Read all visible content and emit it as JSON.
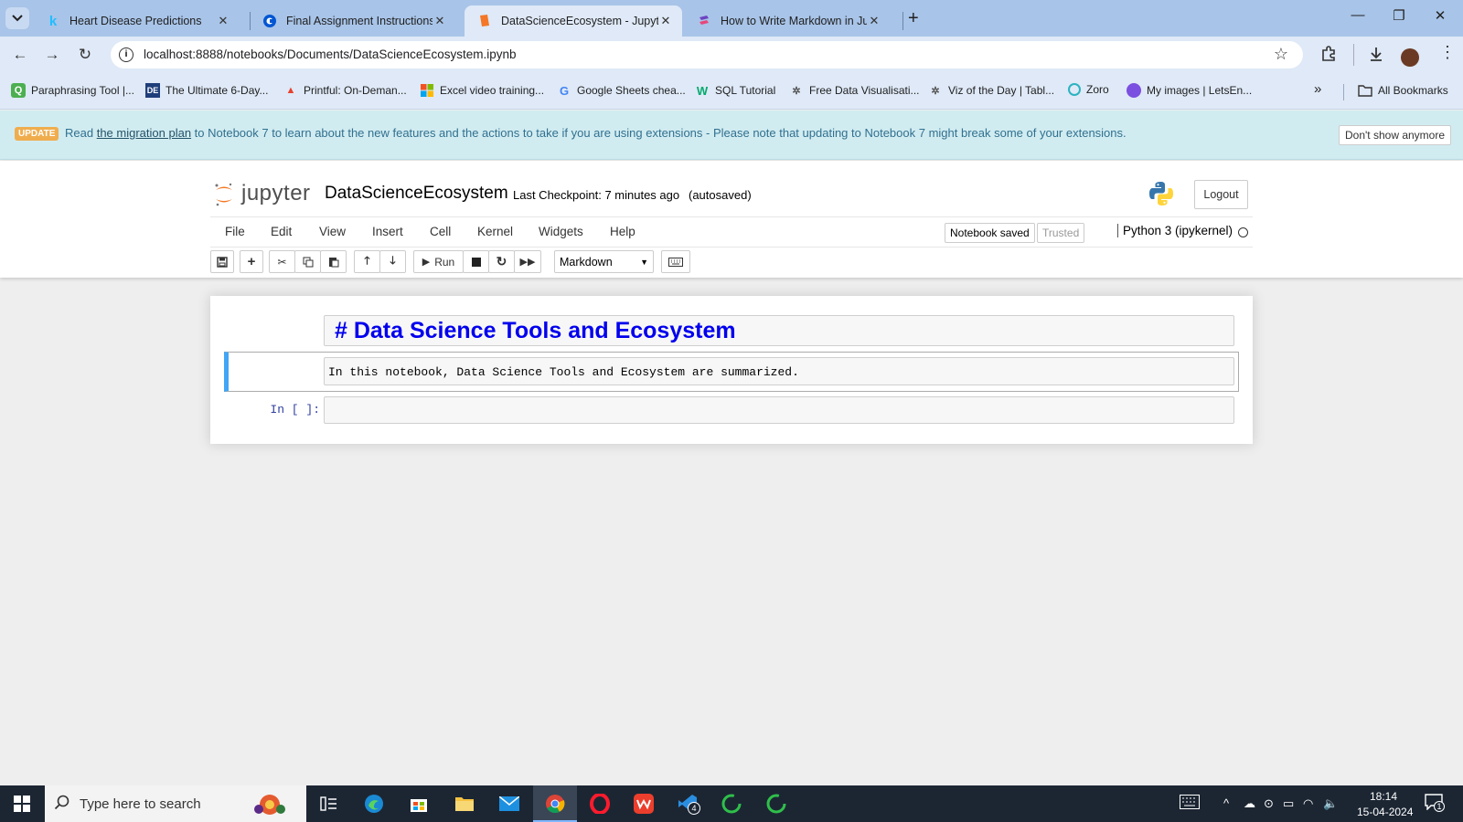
{
  "browser": {
    "tabs": [
      {
        "title": "Heart Disease Predictions",
        "favicon": "kaggle-icon"
      },
      {
        "title": "Final Assignment Instructions: C",
        "favicon": "coursera-icon"
      },
      {
        "title": "DataScienceEcosystem - Jupyte",
        "favicon": "jupyter-icon",
        "active": true
      },
      {
        "title": "How to Write Markdown in Jup",
        "favicon": "markdown-icon"
      }
    ],
    "url": "localhost:8888/notebooks/Documents/DataScienceEcosystem.ipynb",
    "bookmarks": [
      "Paraphrasing Tool |...",
      "The Ultimate 6-Day...",
      "Printful: On-Deman...",
      "Excel video training...",
      "Google Sheets chea...",
      "SQL Tutorial",
      "Free Data Visualisati...",
      "Viz of the Day | Tabl...",
      "Zoro",
      "My images | LetsEn..."
    ],
    "bookmarks_overflow": "»",
    "all_bookmarks": "All Bookmarks"
  },
  "banner": {
    "badge": "UPDATE",
    "prefix": "Read ",
    "link": "the migration plan",
    "suffix": " to Notebook 7 to learn about the new features and the actions to take if you are using extensions - Please note that updating to Notebook 7 might break some of your extensions.",
    "dismiss": "Don't show anymore"
  },
  "jupyter": {
    "logo_text": "jupyter",
    "notebook_name": "DataScienceEcosystem",
    "checkpoint": "Last Checkpoint: 7 minutes ago",
    "autosave": "(autosaved)",
    "logout": "Logout",
    "menu": [
      "File",
      "Edit",
      "View",
      "Insert",
      "Cell",
      "Kernel",
      "Widgets",
      "Help"
    ],
    "notebook_status": "Notebook saved",
    "trusted": "Trusted",
    "kernel": "Python 3 (ipykernel)",
    "run_label": "Run",
    "cell_type": "Markdown"
  },
  "cells": {
    "heading": "# Data Science Tools and Ecosystem",
    "markdown": "In this notebook, Data Science Tools and Ecosystem are summarized.",
    "code_prompt": "In [ ]:"
  },
  "taskbar": {
    "search_placeholder": "Type here to search",
    "time": "18:14",
    "date": "15-04-2024",
    "notif_badge": "1",
    "vscode_badge": "4"
  },
  "colors": {
    "tab_strip": "#a8c4e8",
    "toolbar_bg": "#dfe9f7",
    "banner_bg": "#d1ecf1",
    "heading_blue": "#0000ee",
    "selected_cell_bar": "#42a5f5",
    "jupyter_orange": "#f37726"
  }
}
